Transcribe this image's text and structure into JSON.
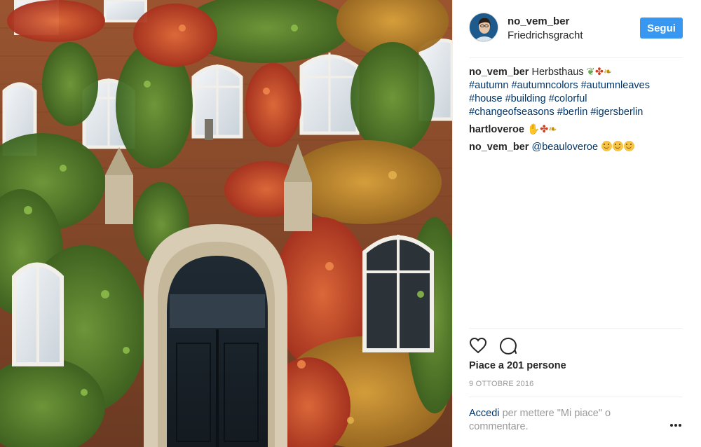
{
  "post": {
    "username": "no_vem_ber",
    "location": "Friedrichsgracht",
    "follow_label": "Segui"
  },
  "caption": {
    "username": "no_vem_ber",
    "text": "Herbsthaus",
    "hashtags": [
      "#autumn",
      "#autumncolors",
      "#autumnleaves",
      "#house",
      "#building",
      "#colorful",
      "#changeofseasons",
      "#berlin",
      "#igersberlin"
    ]
  },
  "comments": [
    {
      "username": "hartloveroe",
      "emojis": [
        "ok-hand",
        "maple-leaf",
        "fallen-leaf"
      ]
    },
    {
      "username": "no_vem_ber",
      "mention": "@beauloveroe",
      "emojis": [
        "smile",
        "smile",
        "smile"
      ]
    }
  ],
  "actions": {
    "like_icon": "heart-icon",
    "comment_icon": "comment-icon"
  },
  "likes_text": "Piace a 201 persone",
  "date_text": "9 OTTOBRE 2016",
  "login_prompt": {
    "link": "Accedi",
    "rest": "per mettere \"Mi piace\" o commentare."
  },
  "more_icon": "ellipsis-icon",
  "colors": {
    "follow_button": "#3897f0",
    "link": "#003569",
    "muted": "#999999",
    "text": "#262626",
    "ivy_green": "#4f7a2a",
    "ivy_red": "#c2452a",
    "brick": "#8a4a2a"
  }
}
